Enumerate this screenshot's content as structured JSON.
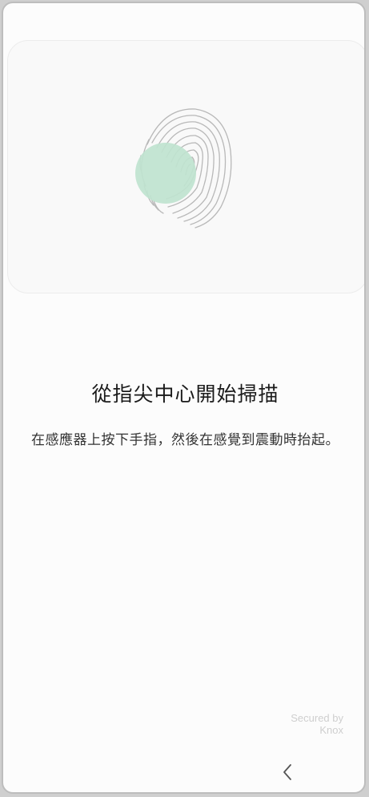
{
  "scan": {
    "title": "從指尖中心開始掃描",
    "instruction": "在感應器上按下手指，然後在感覺到震動時抬起。"
  },
  "footer": {
    "secured_by": "Secured by\nKnox"
  },
  "nav": {
    "back_icon": "chevron-left-icon"
  },
  "colors": {
    "touch_area": "#bfe3cf",
    "fingerprint_lines": "#b8b8b8",
    "background": "#fcfcfc",
    "card": "#f9f9f9"
  }
}
